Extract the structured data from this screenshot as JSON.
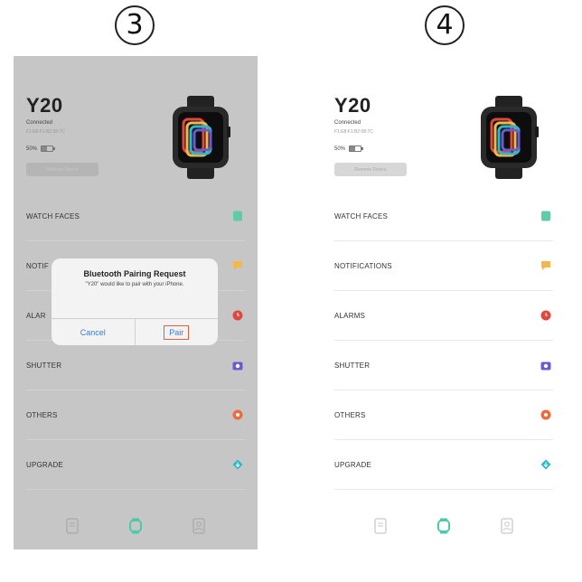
{
  "steps": [
    "3",
    "4"
  ],
  "device": {
    "name": "Y20",
    "status": "Connected",
    "mac": "F1:E8:F1:B2:08:7C",
    "battery": "50%",
    "battery_level": 0.5,
    "button_label": "Remove Device"
  },
  "menu": [
    {
      "label": "WATCH FACES",
      "icon": "watch-face-icon",
      "color": "#5fcba8"
    },
    {
      "label": "NOTIFICATIONS",
      "icon": "message-icon",
      "color": "#f2b84b"
    },
    {
      "label": "ALARMS",
      "icon": "alarm-icon",
      "color": "#e0473e"
    },
    {
      "label": "SHUTTER",
      "icon": "camera-icon",
      "color": "#6b5bd2"
    },
    {
      "label": "OTHERS",
      "icon": "gear-icon",
      "color": "#f06a3c"
    },
    {
      "label": "UPGRADE",
      "icon": "upgrade-icon",
      "color": "#2db8c9"
    }
  ],
  "menu_p3_visible": [
    "WATCH FACES",
    "NOTIF",
    "ALAR",
    "SHUTTER",
    "OTHERS",
    "UPGRADE"
  ],
  "tabs": [
    {
      "icon": "sport-icon",
      "active": false
    },
    {
      "icon": "device-icon",
      "active": true
    },
    {
      "icon": "profile-icon",
      "active": false
    }
  ],
  "colors": {
    "accent": "#4cc9a8",
    "inactive": "#c9c9c9"
  },
  "dialog": {
    "title": "Bluetooth Pairing Request",
    "message": "\"Y20\" would like to pair with your iPhone.",
    "cancel": "Cancel",
    "pair": "Pair"
  }
}
